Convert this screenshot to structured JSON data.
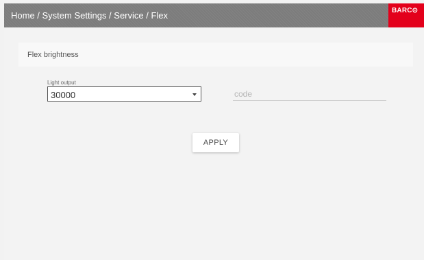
{
  "header": {
    "breadcrumb": "Home / System Settings / Service / Flex",
    "logo_text": "BARC⊙"
  },
  "section": {
    "title": "Flex brightness"
  },
  "light_output": {
    "label": "Light output",
    "value": "30000"
  },
  "code": {
    "placeholder": "code",
    "value": ""
  },
  "actions": {
    "apply_label": "APPLY"
  },
  "colors": {
    "header_bg": "#7c7c7c",
    "brand_red": "#e3001b",
    "page_bg": "#f3f3f3"
  }
}
